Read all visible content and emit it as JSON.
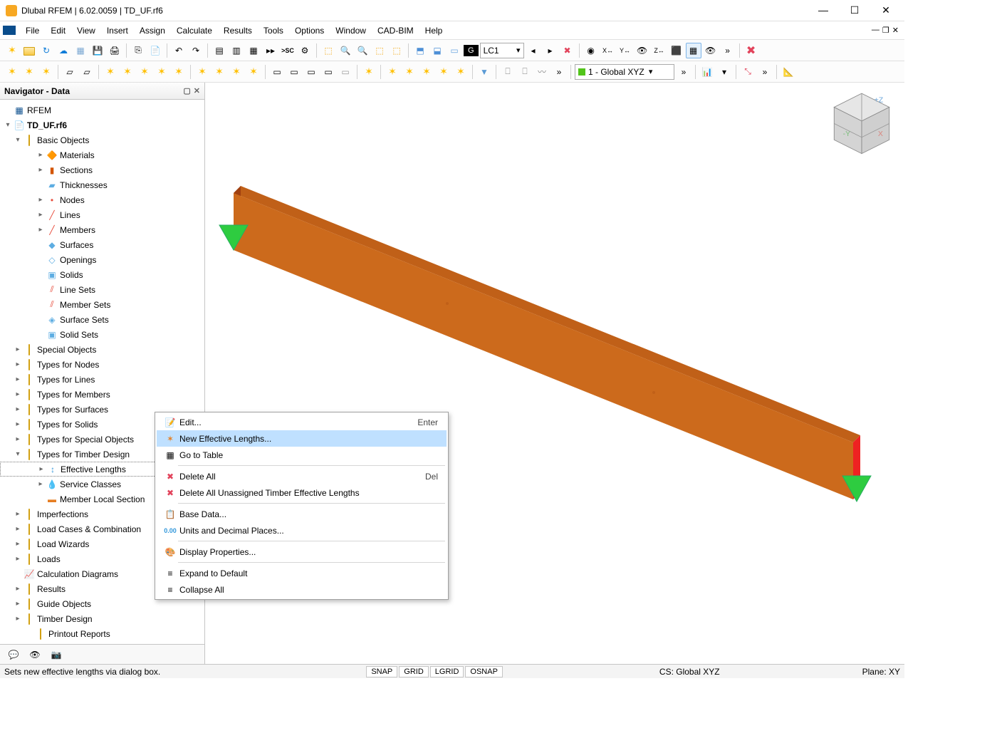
{
  "title": "Dlubal RFEM | 6.02.0059 | TD_UF.rf6",
  "menu": [
    "File",
    "Edit",
    "View",
    "Insert",
    "Assign",
    "Calculate",
    "Results",
    "Tools",
    "Options",
    "Window",
    "CAD-BIM",
    "Help"
  ],
  "toolbar1": {
    "g_label": "G",
    "lc_label": "LC1"
  },
  "toolbar2": {
    "global_combo": "1 - Global XYZ"
  },
  "navigator": {
    "title": "Navigator - Data",
    "root": "RFEM",
    "project": "TD_UF.rf6",
    "basic_objects": "Basic Objects",
    "materials": "Materials",
    "sections": "Sections",
    "thicknesses": "Thicknesses",
    "nodes": "Nodes",
    "lines": "Lines",
    "members": "Members",
    "surfaces": "Surfaces",
    "openings": "Openings",
    "solids": "Solids",
    "line_sets": "Line Sets",
    "member_sets": "Member Sets",
    "surface_sets": "Surface Sets",
    "solid_sets": "Solid Sets",
    "special_objects": "Special Objects",
    "types_nodes": "Types for Nodes",
    "types_lines": "Types for Lines",
    "types_members": "Types for Members",
    "types_surfaces": "Types for Surfaces",
    "types_solids": "Types for Solids",
    "types_special": "Types for Special Objects",
    "types_timber": "Types for Timber Design",
    "effective_lengths": "Effective Lengths",
    "service_classes": "Service Classes",
    "member_local_section": "Member Local Section",
    "imperfections": "Imperfections",
    "load_cases_comb": "Load Cases & Combination",
    "load_wizards": "Load Wizards",
    "loads": "Loads",
    "calc_diagrams": "Calculation Diagrams",
    "results": "Results",
    "guide_objects": "Guide Objects",
    "timber_design": "Timber Design",
    "printout_reports": "Printout Reports"
  },
  "context_menu": {
    "edit": "Edit...",
    "edit_shortcut": "Enter",
    "new_eff": "New Effective Lengths...",
    "go_table": "Go to Table",
    "delete_all": "Delete All",
    "delete_all_shortcut": "Del",
    "delete_unassigned": "Delete All Unassigned Timber Effective Lengths",
    "base_data": "Base Data...",
    "units": "Units and Decimal Places...",
    "display_props": "Display Properties...",
    "expand_default": "Expand to Default",
    "collapse_all": "Collapse All"
  },
  "status": {
    "msg": "Sets new effective lengths via dialog box.",
    "snap": "SNAP",
    "grid": "GRID",
    "lgrid": "LGRID",
    "osnap": "OSNAP",
    "cs": "CS: Global XYZ",
    "plane": "Plane: XY"
  }
}
